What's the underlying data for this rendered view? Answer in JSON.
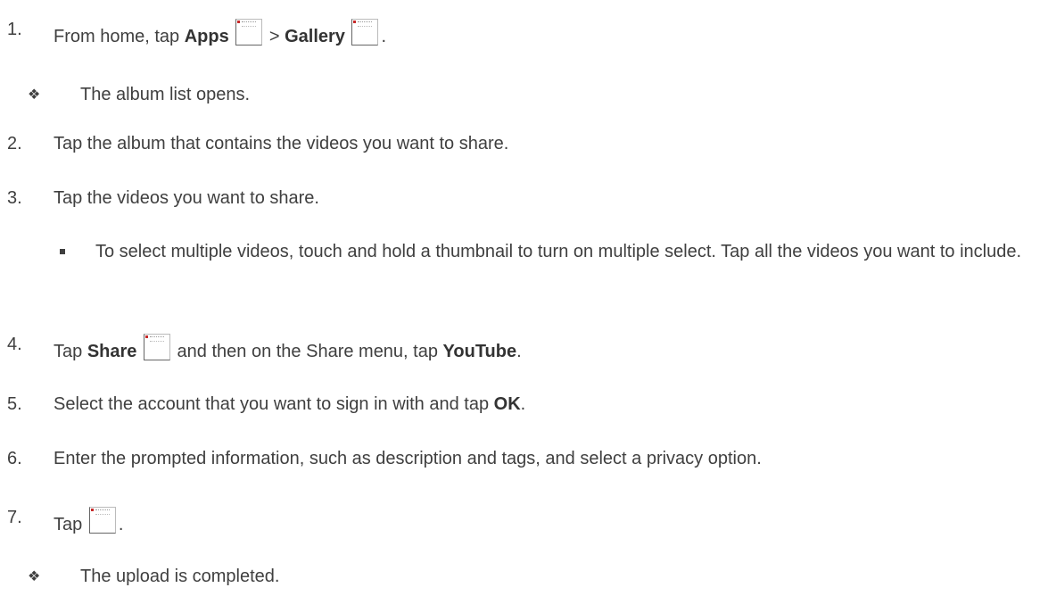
{
  "steps": {
    "s1": {
      "num": "1.",
      "pre": "From home, tap ",
      "apps": "Apps",
      "sep": " > ",
      "gallery": "Gallery",
      "apps_icon": "apps-icon",
      "gallery_icon": "gallery-icon",
      "end": "."
    },
    "n1": {
      "bullet": "❖",
      "text": "The album list opens."
    },
    "s2": {
      "num": "2.",
      "text": "Tap the album that contains the videos you want to share."
    },
    "s3": {
      "num": "3.",
      "text": "Tap the videos you want to share."
    },
    "b3": {
      "text": "To select multiple videos, touch and hold a thumbnail to turn on multiple select. Tap all the videos you want to include."
    },
    "s4": {
      "num": "4.",
      "pre": "Tap ",
      "share": "Share",
      "mid": " and then on the Share menu, tap ",
      "youtube": "YouTube",
      "end": ".",
      "share_icon": "share-icon"
    },
    "s5": {
      "num": "5.",
      "pre": "Select the account that you want to sign in with and tap ",
      "ok": "OK",
      "end": "."
    },
    "s6": {
      "num": "6.",
      "text": "Enter the prompted information, such as description and tags, and select a privacy option."
    },
    "s7": {
      "num": "7.",
      "pre": "Tap ",
      "end": ".",
      "upload_icon": "upload-icon"
    },
    "n7": {
      "bullet": "❖",
      "text": "The upload is completed."
    }
  }
}
